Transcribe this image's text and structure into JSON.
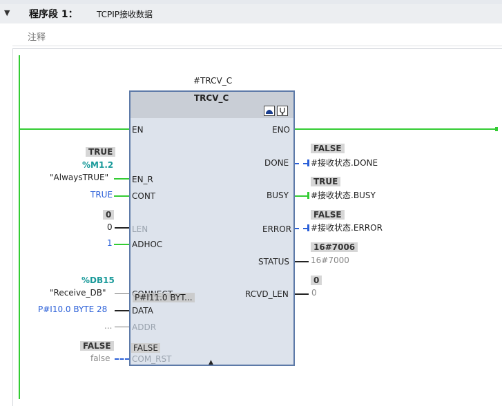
{
  "segment": {
    "collapse_icon": "▼",
    "title": "程序段 1：",
    "name": "TCPIP接收数据",
    "comment": "注释"
  },
  "block": {
    "instance": "#TRCV_C",
    "type": "TRCV_C"
  },
  "inputs": {
    "en": "EN",
    "en_r": {
      "pin": "EN_R",
      "state": "TRUE",
      "addr": "%M1.2",
      "operand": "\"AlwaysTRUE\""
    },
    "cont": {
      "pin": "CONT",
      "value": "TRUE"
    },
    "len": {
      "pin": "LEN",
      "state": "0",
      "value": "0"
    },
    "adhoc": {
      "pin": "ADHOC",
      "value": "1"
    },
    "connect": {
      "pin": "CONNECT",
      "addr": "%DB15",
      "operand": "\"Receive_DB\"",
      "overlay": "P#I11.0 BYT..."
    },
    "data": {
      "pin": "DATA",
      "value": "P#I10.0 BYTE 28"
    },
    "addr": {
      "pin": "ADDR",
      "value": "..."
    },
    "com_rst": {
      "pin": "COM_RST",
      "state": "FALSE",
      "value": "false",
      "inner": "FALSE"
    }
  },
  "outputs": {
    "eno": "ENO",
    "done": {
      "pin": "DONE",
      "state": "FALSE",
      "operand": "#接收状态.DONE"
    },
    "busy": {
      "pin": "BUSY",
      "state": "TRUE",
      "operand": "#接收状态.BUSY"
    },
    "error": {
      "pin": "ERROR",
      "state": "FALSE",
      "operand": "#接收状态.ERROR"
    },
    "status": {
      "pin": "STATUS",
      "state": "16#7006",
      "value": "16#7000"
    },
    "rcvd_len": {
      "pin": "RCVD_LEN",
      "state": "0",
      "value": "0"
    }
  },
  "icons": {
    "db_icon": "database-icon",
    "diag_icon": "stethoscope-icon"
  },
  "colors": {
    "power_flow": "#33cc33",
    "signal": "#2a5fd8",
    "block_border": "#5d7aa8"
  }
}
